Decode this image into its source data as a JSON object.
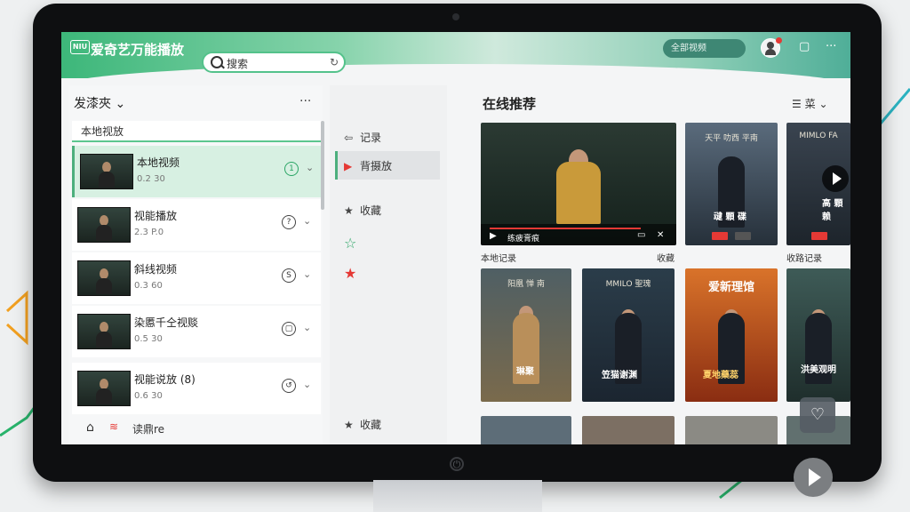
{
  "app": {
    "logo_text": "NIU",
    "title": "爱奇艺万能播放"
  },
  "search": {
    "placeholder": "搜索"
  },
  "topbar": {
    "pill_text": "全部视频",
    "icon_layout": "▢",
    "icon_more": "···"
  },
  "left_panel": {
    "header": "发漆夾",
    "header_chevron": "⌄",
    "more": "···",
    "subheader": "本地视放",
    "items": [
      {
        "title": "本地视频",
        "meta": "0.2 30",
        "badge": "1",
        "badge_green": true
      },
      {
        "title": "视能播放",
        "meta": "2.3 P.0",
        "badge": "?",
        "badge_green": false
      },
      {
        "title": "斜线视频",
        "meta": "0.3 60",
        "badge": "S",
        "badge_green": false
      },
      {
        "title": "染慝千仝视赕",
        "meta": "0.5 30",
        "badge": "▢",
        "badge_green": false
      },
      {
        "title": "视能说放 (8)",
        "meta": "0.6 30",
        "badge": "↺",
        "badge_green": false
      }
    ],
    "chevron": "⌄",
    "footer": "读鼎re"
  },
  "middle_panel": {
    "items": [
      {
        "label": "记录",
        "icon": "⇦"
      },
      {
        "label": "背摄放",
        "icon": "▶"
      },
      {
        "label": "收藏",
        "icon": "★"
      },
      {
        "label": "",
        "icon": "☆"
      },
      {
        "label": "",
        "icon": "★"
      },
      {
        "label": "收藏",
        "icon": "★"
      }
    ]
  },
  "right_panel": {
    "title": "在线推荐",
    "sort_label": "菜",
    "sort_icon": "☰",
    "sort_chevron": "⌄",
    "featured": {
      "caption": "本地记录",
      "label_right": "收藏",
      "play_text": "练疲膏痕"
    },
    "row1": [
      {
        "top": "天平 叻西 平南",
        "caption": "叇 顆 碟",
        "label": ""
      },
      {
        "top": "MIMLO FA",
        "caption": "高 顆 赖",
        "label": "收路记录"
      }
    ],
    "row2": [
      {
        "top": "阳凰 惮 南",
        "caption": "琳聚"
      },
      {
        "top": "MMILO 聖瑰",
        "caption": "笠猫谢渊"
      },
      {
        "top": "爱新理馆",
        "caption": "夏地藥蕊"
      },
      {
        "top": "",
        "caption": "洪美观明"
      }
    ]
  },
  "colors": {
    "accent": "#3db77a",
    "red": "#e53935"
  }
}
